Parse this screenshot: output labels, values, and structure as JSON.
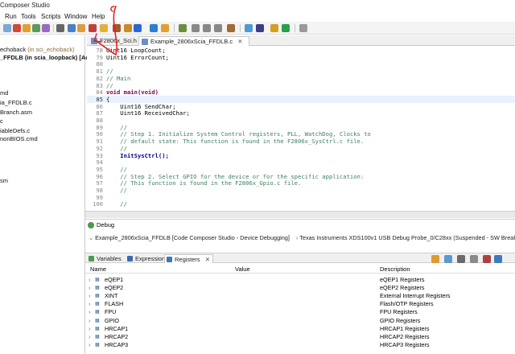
{
  "window": {
    "title": "Composer Studio"
  },
  "menu": [
    "Run",
    "Tools",
    "Scripts",
    "Window",
    "Help"
  ],
  "explorer": {
    "rows": [
      {
        "text": "echoback",
        "hint": "(in sci_echoback)",
        "selected": false
      },
      {
        "text": "_FFDLB (in scia_loopback)",
        "hint": "[Active",
        "selected": true
      },
      {
        "text": "md",
        "hint": "",
        "selected": false
      },
      {
        "text": "ia_FFDLB.c",
        "hint": "",
        "selected": false
      },
      {
        "text": "Branch.asm",
        "hint": "",
        "selected": false
      },
      {
        "text": "c",
        "hint": "",
        "selected": false
      },
      {
        "text": "iableDefs.c",
        "hint": "",
        "selected": false
      },
      {
        "text": "nonBIOS.cmd",
        "hint": "",
        "selected": false
      },
      {
        "text": "sm",
        "hint": "",
        "selected": false
      }
    ]
  },
  "editor": {
    "tabs": [
      {
        "label": "F2806x_Sci.h",
        "active": false
      },
      {
        "label": "Example_2806xScia_FFDLB.c",
        "active": true
      }
    ],
    "lines": [
      {
        "n": "78",
        "text": "Uint16 LoopCount;",
        "kind": ""
      },
      {
        "n": "79",
        "text": "Uint16 ErrorCount;",
        "kind": ""
      },
      {
        "n": "80",
        "text": "",
        "kind": ""
      },
      {
        "n": "81",
        "text": "//",
        "kind": "cmt"
      },
      {
        "n": "82",
        "text": "// Main",
        "kind": "cmt"
      },
      {
        "n": "83",
        "text": "//",
        "kind": "cmt"
      },
      {
        "n": "84",
        "text": "void main(void)",
        "kind": "kw"
      },
      {
        "n": "85",
        "text": "{",
        "kind": ""
      },
      {
        "n": "86",
        "text": "    Uint16 SendChar;",
        "kind": ""
      },
      {
        "n": "87",
        "text": "    Uint16 ReceivedChar;",
        "kind": ""
      },
      {
        "n": "88",
        "text": "",
        "kind": ""
      },
      {
        "n": "89",
        "text": "    //",
        "kind": "cmt"
      },
      {
        "n": "90",
        "text": "    // Step 1. Initialize System Control registers, PLL, WatchDog, Clocks to",
        "kind": "cmt"
      },
      {
        "n": "91",
        "text": "    // default state: This function is found in the F2806x_SysCtrl.c file.",
        "kind": "cmt"
      },
      {
        "n": "92",
        "text": "    //",
        "kind": "cmt"
      },
      {
        "n": "93",
        "text": "    InitSysCtrl();",
        "kind": "fn"
      },
      {
        "n": "94",
        "text": "",
        "kind": ""
      },
      {
        "n": "95",
        "text": "    //",
        "kind": "cmt"
      },
      {
        "n": "96",
        "text": "    // Step 2. Select GPIO for the device or for the specific application:",
        "kind": "cmt"
      },
      {
        "n": "97",
        "text": "    // This function is found in the F2806x_Gpio.c file.",
        "kind": "cmt"
      },
      {
        "n": "98",
        "text": "    //",
        "kind": "cmt"
      },
      {
        "n": "99",
        "text": "",
        "kind": ""
      },
      {
        "n": "100",
        "text": "    //",
        "kind": "cmt"
      }
    ]
  },
  "debug": {
    "tab_label": "Debug",
    "session": "Example_2806xScia_FFDLB [Code Composer Studio - Device Debugging]",
    "probe": "Texas Instruments XDS100v1 USB Debug Probe_0/C28xx (Suspended - SW Breakpoi"
  },
  "registers_view": {
    "tabs": [
      "Variables",
      "Expressions",
      "Registers"
    ],
    "columns": {
      "name": "Name",
      "value": "Value",
      "description": "Description"
    },
    "rows": [
      {
        "name": "eQEP1",
        "value": "",
        "description": "eQEP1 Registers"
      },
      {
        "name": "eQEP2",
        "value": "",
        "description": "eQEP2 Registers"
      },
      {
        "name": "XINT",
        "value": "",
        "description": "External Interrupt Registers"
      },
      {
        "name": "FLASH",
        "value": "",
        "description": "Flash/OTP Registers"
      },
      {
        "name": "FPU",
        "value": "",
        "description": "FPU Registers"
      },
      {
        "name": "GPIO",
        "value": "",
        "description": "GPIO Registers"
      },
      {
        "name": "HRCAP1",
        "value": "",
        "description": "HRCAP1 Registers"
      },
      {
        "name": "HRCAP2",
        "value": "",
        "description": "HRCAP2 Registers"
      },
      {
        "name": "HRCAP3",
        "value": "",
        "description": "HRCAP3 Registers"
      }
    ]
  },
  "icons": {
    "toolbar": [
      "bug-icon",
      "run-icon",
      "stop-icon",
      "step-icon",
      "grid-icon",
      "debug-icon",
      "connect-icon",
      "build-icon",
      "gear-icon",
      "search-icon",
      "pin-icon"
    ],
    "annotation": "red-arrow-annotation"
  },
  "colors": {
    "annotation": "#e02020",
    "comment": "#3f7f5f",
    "keyword": "#7f0055",
    "cursor_line": "#e8f2fe"
  }
}
